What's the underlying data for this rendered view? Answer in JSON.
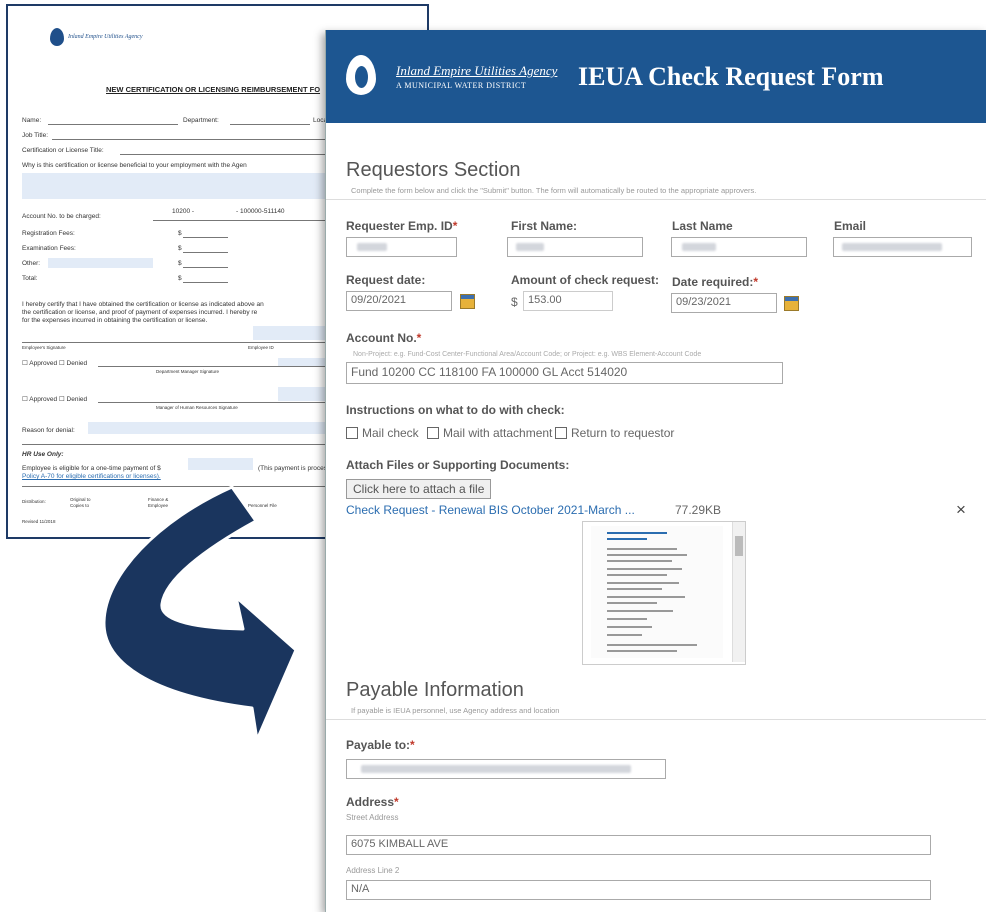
{
  "colors": {
    "brand_blue": "#1d5691",
    "required_mark": "#c0392b",
    "link": "#2b6db0",
    "arrow": "#1a355e"
  },
  "paper_form": {
    "title": "NEW CERTIFICATION OR LICENSING REIMBURSEMENT FO",
    "logo_name": "Inland Empire Utilities Agency",
    "rows": {
      "name": "Name:",
      "department": "Department:",
      "location": "Location",
      "job_title": "Job Title:",
      "cert_title": "Certification or License Title:",
      "why": "Why is this certification or license beneficial to your employment with the Agen",
      "account_no": "Account No. to be charged:",
      "account_value_1": "10200 -",
      "account_value_2": "- 100000-511140",
      "registration": "Registration Fees:",
      "examination": "Examination Fees:",
      "other": "Other:",
      "total": "Total:",
      "dollar": "$",
      "certify_1": "I hereby certify that I have obtained the certification or license as indicated above an",
      "certify_2": "the certification or license, and proof of payment of expenses incurred. I hereby re",
      "certify_3": "for the expenses incurred in obtaining the certification or license.",
      "employee_signature": "Employee's Signature",
      "employee_id": "Employee ID",
      "approved_1": "☐ Approved  ☐ Denied",
      "dept_manager_sig": "Department Manager Signature",
      "approved_2": "☐ Approved  ☐ Denied",
      "hr_manager_sig": "Manager of Human Resources Signature",
      "reason": "Reason for denial:",
      "hr_use": "HR Use Only:",
      "eligible_1": "Employee is eligible for a one-time payment of $",
      "eligible_2": "(This payment is processe",
      "policy": "Policy A-70 for eligible certifications or licenses).",
      "distribution": "Distribution:",
      "original": "Original to",
      "copies": "Copies to",
      "finance": "Finance &",
      "employee": "Employee",
      "personnel": "Personnel File",
      "revised": "Revised 11/2018"
    }
  },
  "banner": {
    "agency_name": "Inland Empire Utilities Agency",
    "district": "A MUNICIPAL WATER DISTRICT",
    "form_title": "IEUA Check Request Form"
  },
  "requestors": {
    "heading": "Requestors Section",
    "description": "Complete the form below and click the \"Submit\" button. The form will automatically be routed to the appropriate approvers.",
    "emp_id_label": "Requester Emp. ID",
    "first_name_label": "First Name:",
    "last_name_label": "Last Name",
    "email_label": "Email",
    "request_date_label": "Request date:",
    "request_date_value": "09/20/2021",
    "amount_label": "Amount of check request:",
    "amount_currency": "$",
    "amount_value": "153.00",
    "date_required_label": "Date required:",
    "date_required_value": "09/23/2021",
    "account_label": "Account No.",
    "account_hint": "Non-Project: e.g. Fund-Cost Center-Functional Area/Account Code; or Project: e.g. WBS Element-Account Code",
    "account_value": "Fund 10200 CC 118100 FA 100000 GL Acct 514020",
    "instructions_label": "Instructions on what to do with check:",
    "options": [
      "Mail check",
      "Mail with attachment",
      "Return to requestor"
    ],
    "attach_label": "Attach Files or Supporting Documents:",
    "attach_button": "Click here to attach a file",
    "file_name": "Check Request - Renewal BIS October 2021-March ...",
    "file_size": "77.29KB",
    "remove_symbol": "×"
  },
  "payable": {
    "heading": "Payable Information",
    "description": "If payable is IEUA personnel, use Agency address and location",
    "payable_to_label": "Payable to:",
    "address_label": "Address",
    "street_label": "Street Address",
    "street_value": "6075 KIMBALL AVE",
    "line2_label": "Address Line 2",
    "line2_value": "N/A"
  }
}
